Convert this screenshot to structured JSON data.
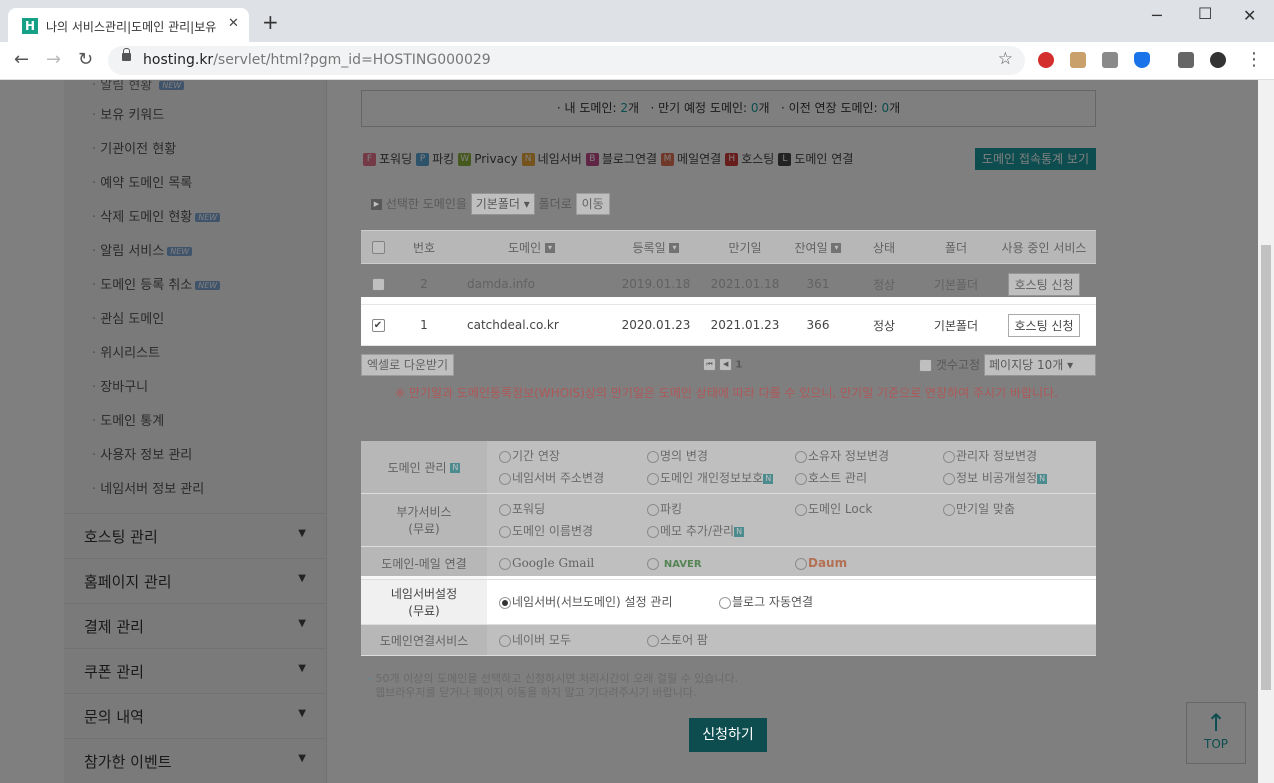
{
  "browser": {
    "tab_title": "나의 서비스관리|도메인 관리|보유",
    "favicon_letter": "H",
    "url_host": "hosting.kr",
    "url_path": "/servlet/html?pgm_id=HOSTING000029"
  },
  "sidebar": {
    "sub_items": [
      {
        "label": "보유 키워드",
        "new": false
      },
      {
        "label": "기관이전 현황",
        "new": false
      },
      {
        "label": "예약 도메인 목록",
        "new": false
      },
      {
        "label": "삭제 도메인 현황",
        "new": true
      },
      {
        "label": "알림 서비스",
        "new": true
      },
      {
        "label": "도메인 등록 취소",
        "new": true
      },
      {
        "label": "관심 도메인",
        "new": false
      },
      {
        "label": "위시리스트",
        "new": false
      },
      {
        "label": "장바구니",
        "new": false
      },
      {
        "label": "도메인 통계",
        "new": false
      },
      {
        "label": "사용자 정보 관리",
        "new": false
      },
      {
        "label": "네임서버 정보 관리",
        "new": false
      }
    ],
    "new_badge": "NEW",
    "main_items": [
      "호스팅 관리",
      "홈페이지 관리",
      "결제 관리",
      "쿠폰 관리",
      "문의 내역",
      "참가한 이벤트"
    ]
  },
  "summary": {
    "my_label": "· 내 도메인: ",
    "my_count": "2",
    "my_unit": "개",
    "expire_label": "· 만기 예정 도메인: ",
    "expire_count": "0",
    "expire_unit": "개",
    "transfer_label": "· 이전 연장 도메인: ",
    "transfer_count": "0",
    "transfer_unit": "개"
  },
  "legend": [
    {
      "letter": "F",
      "label": "포워딩",
      "color": "#e8748a"
    },
    {
      "letter": "P",
      "label": "파킹",
      "color": "#5aa7d6"
    },
    {
      "letter": "W",
      "label": "Privacy",
      "color": "#8ab33a"
    },
    {
      "letter": "N",
      "label": "네임서버",
      "color": "#e8a73a"
    },
    {
      "letter": "B",
      "label": "블로그연결",
      "color": "#c04a8a"
    },
    {
      "letter": "M",
      "label": "메일연결",
      "color": "#e07050"
    },
    {
      "letter": "H",
      "label": "호스팅",
      "color": "#d03a3a"
    },
    {
      "letter": "L",
      "label": "도메인 연결",
      "color": "#444444"
    }
  ],
  "stats_button": "도메인 접속통계 보기",
  "folder_bar": {
    "label": "선택한 도메인을",
    "folder_select": "기본폴더",
    "suffix": "폴더로",
    "move_button": "이동"
  },
  "table": {
    "headers": [
      "번호",
      "도메인",
      "등록일",
      "만기일",
      "잔여일",
      "상태",
      "폴더",
      "사용 중인 서비스"
    ],
    "rows": [
      {
        "no": "2",
        "domain": "damda.info",
        "reg": "2019.01.18",
        "exp": "2021.01.18",
        "remain": "361",
        "status": "정상",
        "folder": "기본폴더",
        "service": "호스팅 신청",
        "checked": false
      },
      {
        "no": "1",
        "domain": "catchdeal.co.kr",
        "reg": "2020.01.23",
        "exp": "2021.01.23",
        "remain": "366",
        "status": "정상",
        "folder": "기본폴더",
        "service": "호스팅 신청",
        "checked": true
      }
    ]
  },
  "excel_button": "엑셀로 다운받기",
  "pager": {
    "current": "1"
  },
  "fix_count_label": "갯수고정",
  "per_page": "페이지당 10개",
  "notice_red": "※ 만기일과 도메인등록정보(WHOIS)상의 만기일은 도메인 상태에 따라 다를 수 있으니, 만기일 기준으로 연장하여 주시기 바랍니다.",
  "services": {
    "domain_mgmt": {
      "label": "도메인 관리",
      "options": [
        "기간 연장",
        "명의 변경",
        "소유자 정보변경",
        "관리자 정보변경",
        "네임서버 주소변경",
        "도메인 개인정보보호",
        "호스트 관리",
        "정보 비공개설정"
      ]
    },
    "addon": {
      "label1": "부가서비스",
      "label2": "(무료)",
      "options": [
        "포워딩",
        "파킹",
        "도메인 Lock",
        "만기일 맞춤",
        "도메인 이름변경",
        "메모 추가/관리"
      ]
    },
    "mail": {
      "label": "도메인-메일 연결",
      "options": [
        "Google Gmail",
        "NAVER",
        "Daum"
      ]
    },
    "nameserver": {
      "label1": "네임서버설정",
      "label2": "(무료)",
      "options": [
        "네임서버(서브도메인) 설정 관리",
        "블로그 자동연결"
      ]
    },
    "connect": {
      "label": "도메인연결서비스",
      "options": [
        "네이버 모두",
        "스토어 팜"
      ]
    }
  },
  "note_line1": "50개 이상의 도메인을 선택하고 신청하시면 처리시간이 오래 걸릴 수 있습니다.",
  "note_line2": "웹브라우저를 닫거나 페이지 이동을 하지 말고 기다려주시기 바랍니다.",
  "apply_button": "신청하기",
  "top_button": "TOP"
}
